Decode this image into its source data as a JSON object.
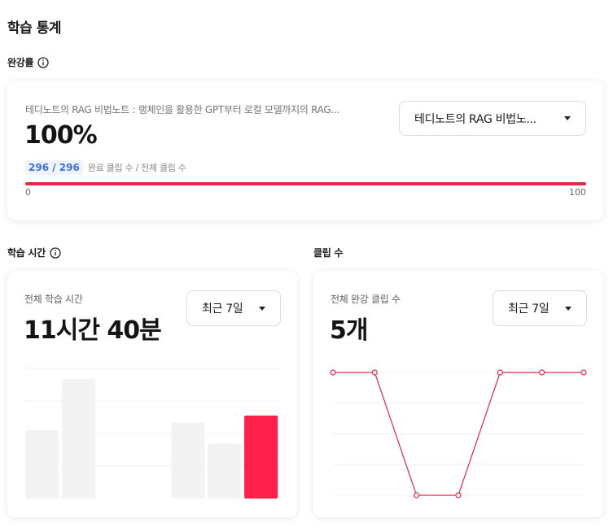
{
  "page": {
    "title": "학습 통계"
  },
  "completion": {
    "section_label": "완강률",
    "course_name": "테디노트의 RAG 비법노트 : 랭체인을 활용한 GPT부터 로컬 모델까지의 RAG...",
    "rate_text": "100%",
    "rate_value": 100,
    "clip_count_text": "296 / 296",
    "clip_desc": "완료 클립 수 / 전체 클립 수",
    "axis_min": "0",
    "axis_max": "100",
    "course_select": {
      "value": "테디노트의 RAG 비법노..."
    }
  },
  "study_time": {
    "section_label": "학습 시간",
    "card_label": "전체 학습 시간",
    "total_text": "11시간 40분",
    "period_select": {
      "value": "최근 7일"
    },
    "bars": [
      0.56,
      0.98,
      0,
      0,
      0.62,
      0.45,
      0.68
    ],
    "bar_color": "#f3f3f3",
    "highlight_color": "#ff1f4b"
  },
  "clips": {
    "section_label": "클립 수",
    "card_label": "전체 완강 클립 수",
    "total_text": "5개",
    "period_select": {
      "value": "최근 7일"
    },
    "points": [
      1,
      1,
      0,
      0,
      1,
      1,
      1
    ],
    "line_color": "#e8264a"
  },
  "icons": {
    "info": "info-circle-icon",
    "caret": "caret-down-icon"
  }
}
